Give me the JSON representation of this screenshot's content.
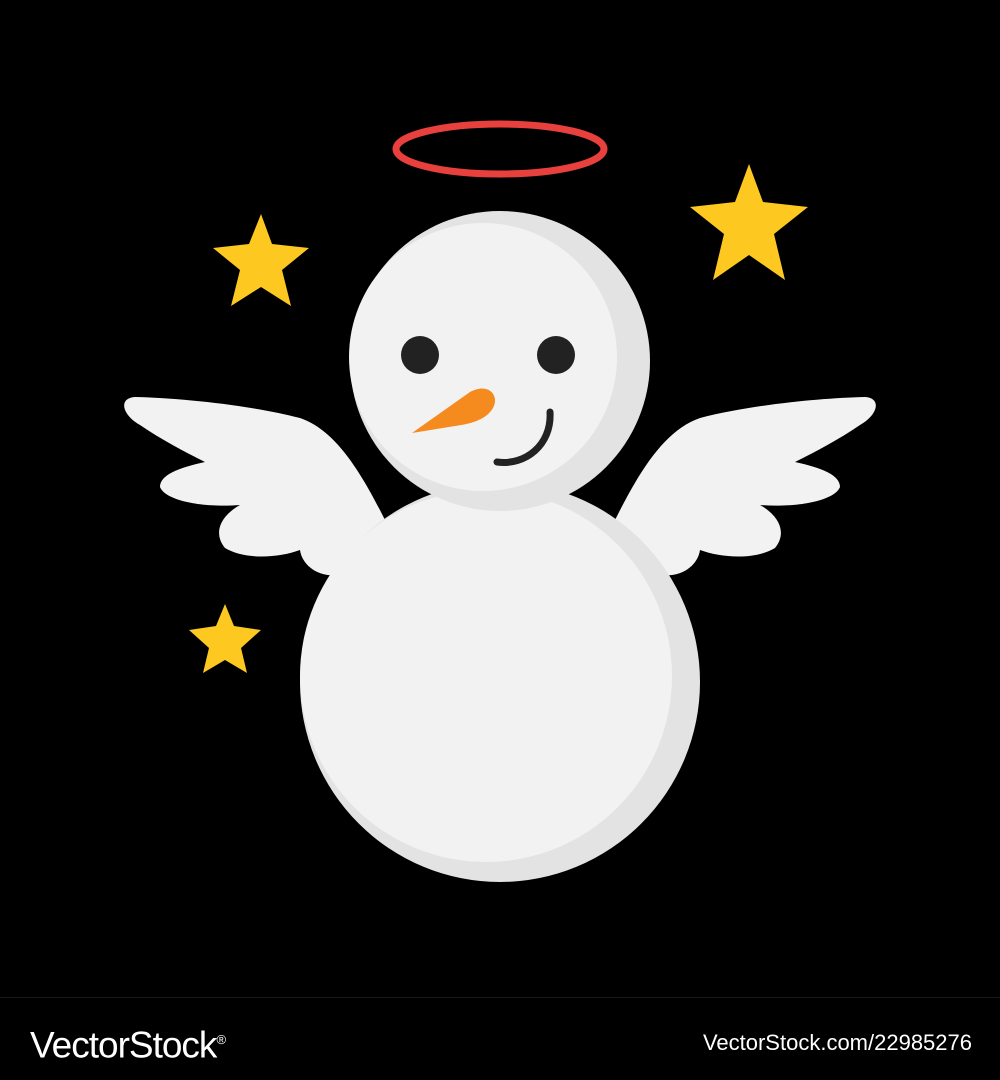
{
  "illustration": {
    "subject": "angel-snowman",
    "colors": {
      "background": "#000000",
      "snow": "#f2f2f2",
      "snow_shade": "#e3e3e3",
      "halo": "#e8403c",
      "stars": "#fdc820",
      "carrot": "#f58a1f",
      "face": "#222222"
    },
    "icons": [
      "halo-icon",
      "star-icon",
      "wing-icon",
      "carrot-nose-icon"
    ]
  },
  "watermark": {
    "brand": "VectorStock",
    "registered_mark": "®",
    "image_id": "VectorStock.com/22985276"
  }
}
